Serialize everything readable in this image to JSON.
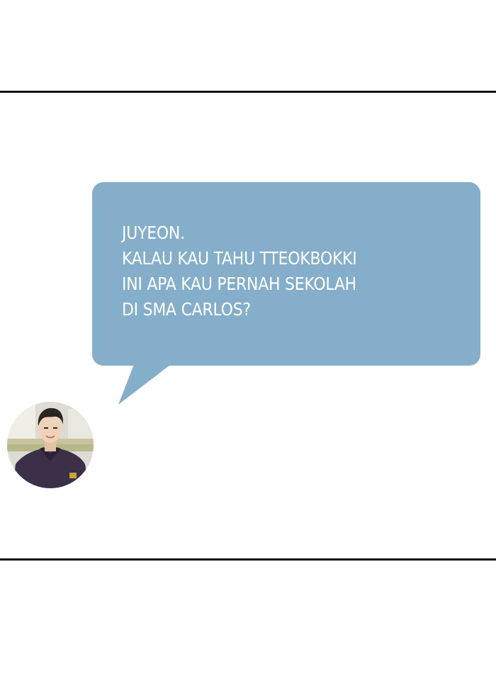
{
  "dialogue": {
    "lines": [
      "JUYEON.",
      "KALAU KAU TAHU TTEOKBOKKI",
      "INI APA KAU PERNAH SEKOLAH",
      "DI SMA CARLOS?"
    ]
  },
  "colors": {
    "bubble": "#84aec9",
    "text": "#ffffff",
    "border": "#111111"
  },
  "icons": {
    "speaker": "character-portrait"
  }
}
